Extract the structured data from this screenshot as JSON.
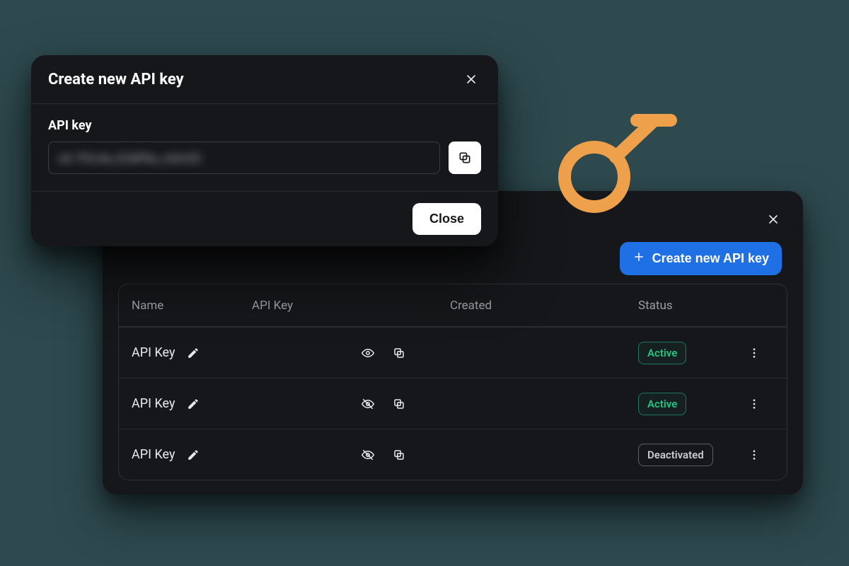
{
  "modal": {
    "title": "Create new API key",
    "field_label": "API key",
    "masked_value": "sk-7f3c4a_E3dP8u_xQm52",
    "close_label": "Close"
  },
  "listPanel": {
    "create_button_label": "Create new API key",
    "columns": {
      "name": "Name",
      "api_key": "API Key",
      "created": "Created",
      "status": "Status"
    },
    "rows": [
      {
        "name": "API Key",
        "visibility": "visible",
        "created": "",
        "status": "Active"
      },
      {
        "name": "API Key",
        "visibility": "hidden",
        "created": "",
        "status": "Active"
      },
      {
        "name": "API Key",
        "visibility": "hidden",
        "created": "",
        "status": "Deactivated"
      }
    ]
  },
  "icons": {
    "close": "close-icon",
    "plus": "plus-icon",
    "pencil": "pencil-icon",
    "eye": "eye-icon",
    "eye_off": "eye-off-icon",
    "copy": "copy-icon",
    "more": "more-vert-icon",
    "key": "key-icon"
  },
  "colors": {
    "accent": "#1f6fe5",
    "success": "#26c281",
    "panel": "#16171a"
  }
}
